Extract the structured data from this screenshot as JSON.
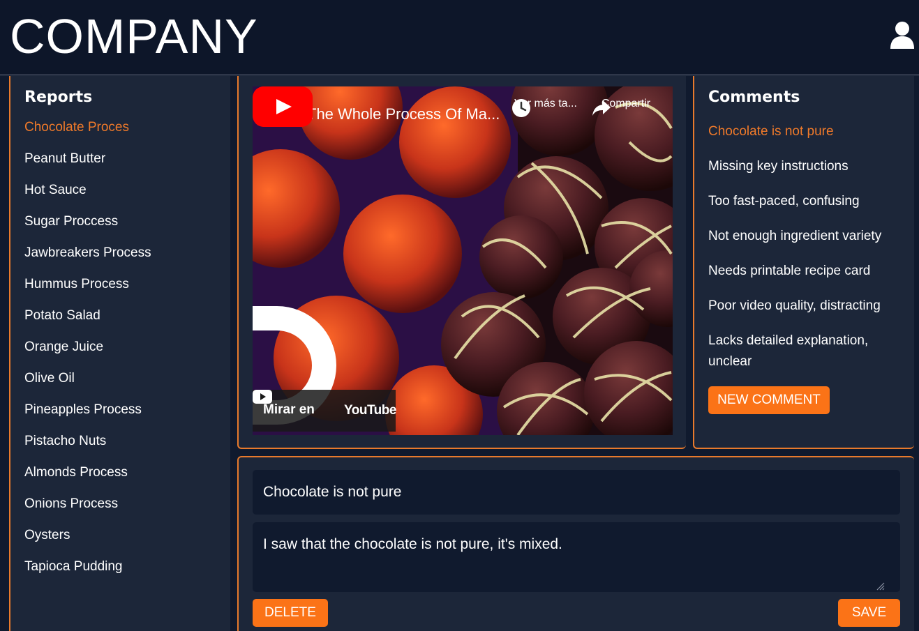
{
  "header": {
    "logo_text": "COMPANY",
    "user_icon": "user-icon"
  },
  "sidebar": {
    "title": "Reports",
    "active_index": 0,
    "items": [
      "Chocolate Proces",
      "Peanut Butter",
      "Hot Sauce",
      "Sugar Proccess",
      "Jawbreakers Process",
      "Hummus Process",
      "Potato Salad",
      "Orange Juice",
      "Olive Oil",
      "Pineapples Process",
      "Pistacho Nuts",
      "Almonds Process",
      "Onions Process",
      "Oysters",
      "Tapioca Pudding"
    ]
  },
  "video": {
    "title": "The Whole Process Of Ma...",
    "watch_later": "Ver más ta...",
    "share": "Compartir",
    "watch_on": "Mirar en",
    "youtube": "YouTube",
    "icons": [
      "clock-icon",
      "share-icon",
      "play-icon",
      "youtube-logo-icon"
    ]
  },
  "comments": {
    "title": "Comments",
    "active_index": 0,
    "items": [
      "Chocolate is not pure",
      "Missing key instructions",
      "Too fast-paced, confusing",
      "Not enough ingredient variety",
      "Needs printable recipe card",
      "Poor video quality, distracting",
      "Lacks detailed explanation, unclear"
    ],
    "new_button": "NEW COMMENT"
  },
  "editor": {
    "title_value": "Chocolate is not pure",
    "body_value": "I saw that the chocolate is not pure, it's mixed.",
    "delete_label": "DELETE",
    "save_label": "SAVE"
  },
  "colors": {
    "accent": "#fb7317",
    "panel": "#1c2639",
    "background": "#101a2e",
    "header": "#0d1629"
  }
}
